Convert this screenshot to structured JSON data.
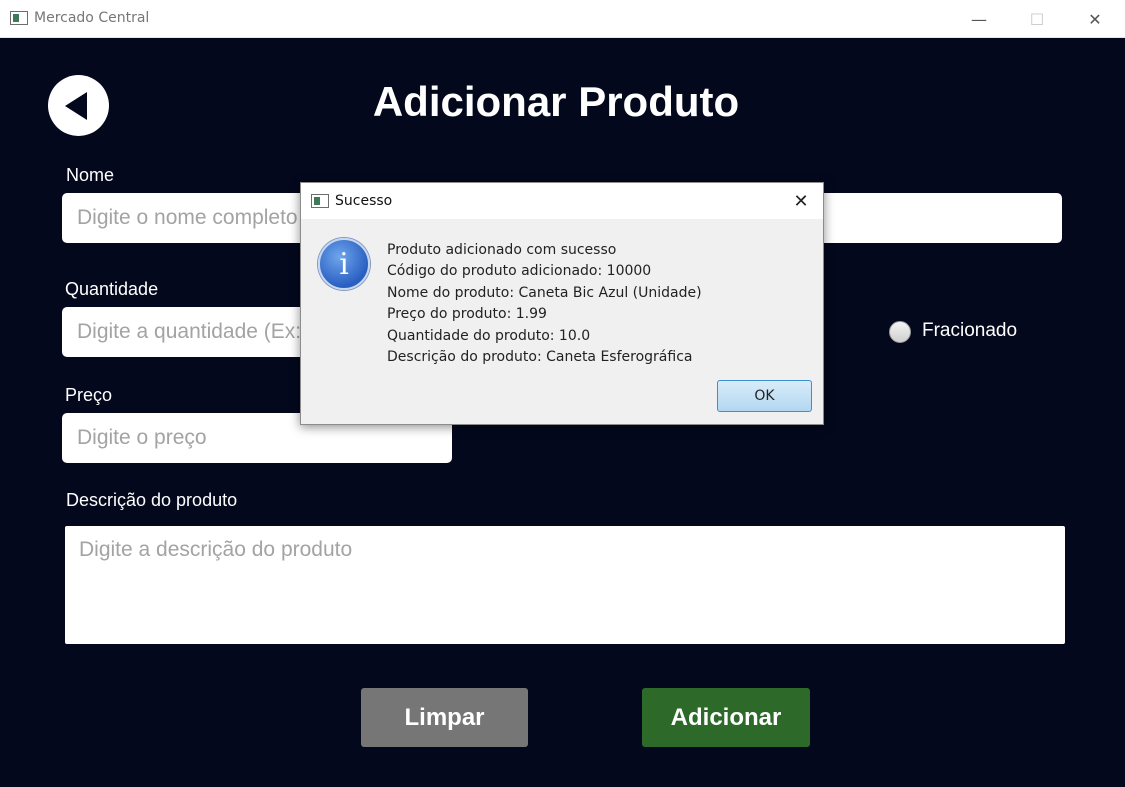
{
  "window": {
    "title": "Mercado Central",
    "controls": {
      "minimize": "—",
      "maximize": "☐",
      "close": "✕"
    }
  },
  "page": {
    "title": "Adicionar Produto",
    "back_icon": "back-arrow-icon"
  },
  "form": {
    "name": {
      "label": "Nome",
      "placeholder": "Digite o nome completo do produto"
    },
    "quantity": {
      "label": "Quantidade",
      "placeholder": "Digite a quantidade (Ex: 10 ou 2.5)"
    },
    "fractional": {
      "label": "Fracionado",
      "checked": false
    },
    "price": {
      "label": "Preço",
      "placeholder": "Digite o preço"
    },
    "description": {
      "label": "Descrição do produto",
      "placeholder": "Digite a descrição do produto"
    }
  },
  "buttons": {
    "clear": "Limpar",
    "add": "Adicionar"
  },
  "dialog": {
    "title": "Sucesso",
    "close": "✕",
    "icon": "info-icon",
    "icon_glyph": "i",
    "lines": [
      "Produto adicionado com sucesso",
      "Código do produto adicionado: 10000",
      "Nome do produto: Caneta Bic Azul (Unidade)",
      "Preço do produto: 1.99",
      "Quantidade do produto: 10.0",
      "Descrição do produto: Caneta Esferográfica"
    ],
    "ok": "OK"
  },
  "colors": {
    "background": "#03081d",
    "clear_button": "#767676",
    "add_button": "#2d6a2a"
  }
}
